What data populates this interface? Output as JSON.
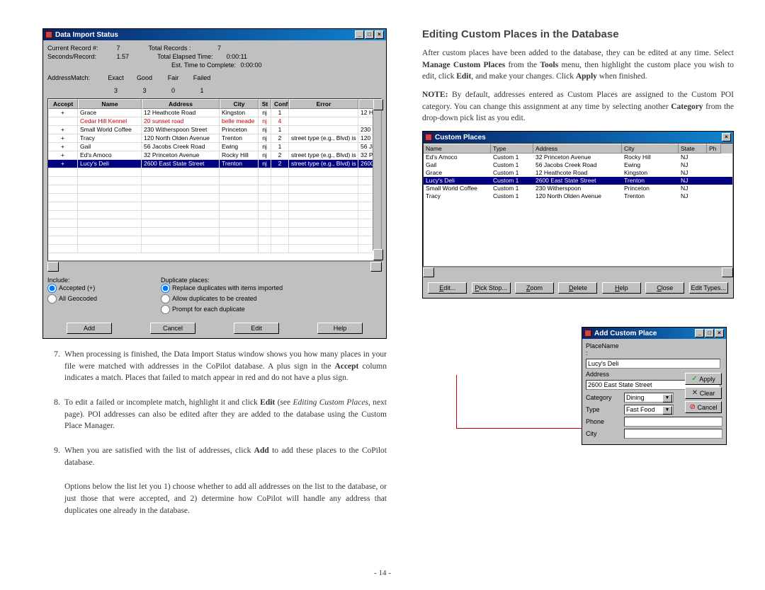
{
  "page_number": "- 14 -",
  "left": {
    "dialog": {
      "title": "Data Import Status",
      "stats": {
        "current_record_label": "Current Record #:",
        "current_record_val": "7",
        "total_records_label": "Total Records :",
        "total_records_val": "7",
        "seconds_record_label": "Seconds/Record:",
        "seconds_record_val": "1.57",
        "total_elapsed_label": "Total Elapsed Time:",
        "total_elapsed_val": "0:00:11",
        "est_time_label": "Est. Time to Complete:",
        "est_time_val": "0:00:00"
      },
      "match": {
        "label": "AddressMatch:",
        "exact_label": "Exact",
        "exact_val": "3",
        "good_label": "Good",
        "good_val": "3",
        "fair_label": "Fair",
        "fair_val": "0",
        "failed_label": "Failed",
        "failed_val": "1"
      },
      "headers": {
        "accept": "Accept",
        "name": "Name",
        "address": "Address",
        "city": "City",
        "st": "St",
        "conf": "Conf",
        "error": "Error"
      },
      "rows": [
        {
          "accept": "+",
          "name": "Grace",
          "address": "12 Heathcote Road",
          "city": "Kingston",
          "st": "nj",
          "conf": "1",
          "error": "",
          "last": "12 H"
        },
        {
          "accept": "",
          "name": "Cedar Hill Kennel",
          "address": "20 sunset road",
          "city": "belle meade",
          "st": "nj",
          "conf": "4",
          "error": "",
          "last": "",
          "red": true
        },
        {
          "accept": "+",
          "name": "Small World Coffee",
          "address": "230 Witherspoon Street",
          "city": "Princeton",
          "st": "nj",
          "conf": "1",
          "error": "",
          "last": "230 \""
        },
        {
          "accept": "+",
          "name": "Tracy",
          "address": "120 North Olden Avenue",
          "city": "Trenton",
          "st": "nj",
          "conf": "2",
          "error": "street type (e.g., Blvd) is incorrect",
          "last": "120 1"
        },
        {
          "accept": "+",
          "name": "Gail",
          "address": "56 Jacobs Creek Road",
          "city": "Ewing",
          "st": "nj",
          "conf": "1",
          "error": "",
          "last": "56 Ji"
        },
        {
          "accept": "+",
          "name": "Ed's Amoco",
          "address": "32 Princeton Avenue",
          "city": "Rocky Hill",
          "st": "nj",
          "conf": "2",
          "error": "street type (e.g., Blvd) is incorrect",
          "last": "32 P"
        },
        {
          "accept": "+",
          "name": "Lucy's Deli",
          "address": "2600 East State Street",
          "city": "Trenton",
          "st": "nj",
          "conf": "2",
          "error": "street type (e.g., Blvd) is incorrect",
          "last": "2600",
          "selected": true
        }
      ],
      "include": {
        "label": "Include:",
        "opt1": "Accepted (+)",
        "opt2": "All Geocoded"
      },
      "duplicate": {
        "label": "Duplicate places:",
        "opt1": "Replace duplicates with items imported",
        "opt2": "Allow duplicates to be created",
        "opt3": "Prompt for each duplicate"
      },
      "buttons": {
        "add": "Add",
        "cancel": "Cancel",
        "edit": "Edit",
        "help": "Help"
      }
    },
    "list": {
      "i7": {
        "num": "7.",
        "text_a": "When processing is finished, the Data Import Status window shows you how many places in your file were matched with addresses in the CoPilot database. A plus sign in the ",
        "bold1": "Accept",
        "text_b": " column indicates a match. Places that failed to match appear in red and do not have a plus sign."
      },
      "i8": {
        "num": "8.",
        "text_a": "To edit a failed or incomplete match, highlight it and click ",
        "bold1": "Edit",
        "text_b": " (see ",
        "italic1": "Editing Custom Places",
        "text_c": ", next page). POI addresses can also be edited after they are added to the database using the Custom Place Manager."
      },
      "i9": {
        "num": "9.",
        "text_a": "When you are satisfied with the list of addresses, click ",
        "bold1": "Add",
        "text_b": " to add these places to the CoPilot database."
      },
      "i9b": "Options below the list let you 1) choose whether to add all addresses on the list to the database, or just those that were accepted, and 2) determine how CoPilot will handle any address that duplicates one already in the database."
    }
  },
  "right": {
    "heading": "Editing Custom Places in the Database",
    "p1_a": "After custom places have been added to the database, they can be edited at any time. Select ",
    "p1_b1": "Manage Custom Places",
    "p1_c": " from the ",
    "p1_b2": "Tools",
    "p1_d": " menu, then highlight the custom place you wish to edit, click ",
    "p1_b3": "Edit",
    "p1_e": ", and make your changes. Click ",
    "p1_b4": "Apply",
    "p1_f": " when finished.",
    "p2_b1": "NOTE:",
    "p2_a": " By default, addresses entered as Custom Places are assigned to the Custom POI category. You can change this assignment at any time by selecting another ",
    "p2_b2": "Category",
    "p2_c": " from the drop-down pick list as you edit.",
    "cp_dialog": {
      "title": "Custom Places",
      "headers": {
        "name": "Name",
        "type": "Type",
        "address": "Address",
        "city": "City",
        "state": "State",
        "ph": "Ph"
      },
      "rows": [
        {
          "name": "Ed's Amoco",
          "type": "Custom 1",
          "address": "32 Princeton Avenue",
          "city": "Rocky Hill",
          "state": "NJ"
        },
        {
          "name": "Gail",
          "type": "Custom 1",
          "address": "56 Jacobs Creek Road",
          "city": "Ewing",
          "state": "NJ"
        },
        {
          "name": "Grace",
          "type": "Custom 1",
          "address": "12 Heathcote Road",
          "city": "Kingston",
          "state": "NJ"
        },
        {
          "name": "Lucy's Deli",
          "type": "Custom 1",
          "address": "2600 East State Street",
          "city": "Trenton",
          "state": "NJ",
          "sel": true
        },
        {
          "name": "Small World Coffee",
          "type": "Custom 1",
          "address": "230 Witherspoon",
          "city": "Princeton",
          "state": "NJ"
        },
        {
          "name": "Tracy",
          "type": "Custom 1",
          "address": "120 North Olden Avenue",
          "city": "Trenton",
          "state": "NJ"
        }
      ],
      "buttons": {
        "edit": "Edit...",
        "pick": "Pick Stop...",
        "zoom": "Zoom",
        "delete": "Delete",
        "help": "Help",
        "close": "Close",
        "types": "Edit Types..."
      }
    },
    "acp_dialog": {
      "title": "Add Custom Place",
      "labels": {
        "placename": "PlaceName :",
        "address": "Address",
        "category": "Category",
        "type": "Type",
        "phone": "Phone",
        "city": "City"
      },
      "values": {
        "placename": "Lucy's Deli",
        "address": "2600 East State Street",
        "category": "Dining",
        "type": "Fast Food",
        "phone": "",
        "city": ""
      },
      "buttons": {
        "apply": "Apply",
        "clear": "Clear",
        "cancel": "Cancel"
      }
    }
  }
}
